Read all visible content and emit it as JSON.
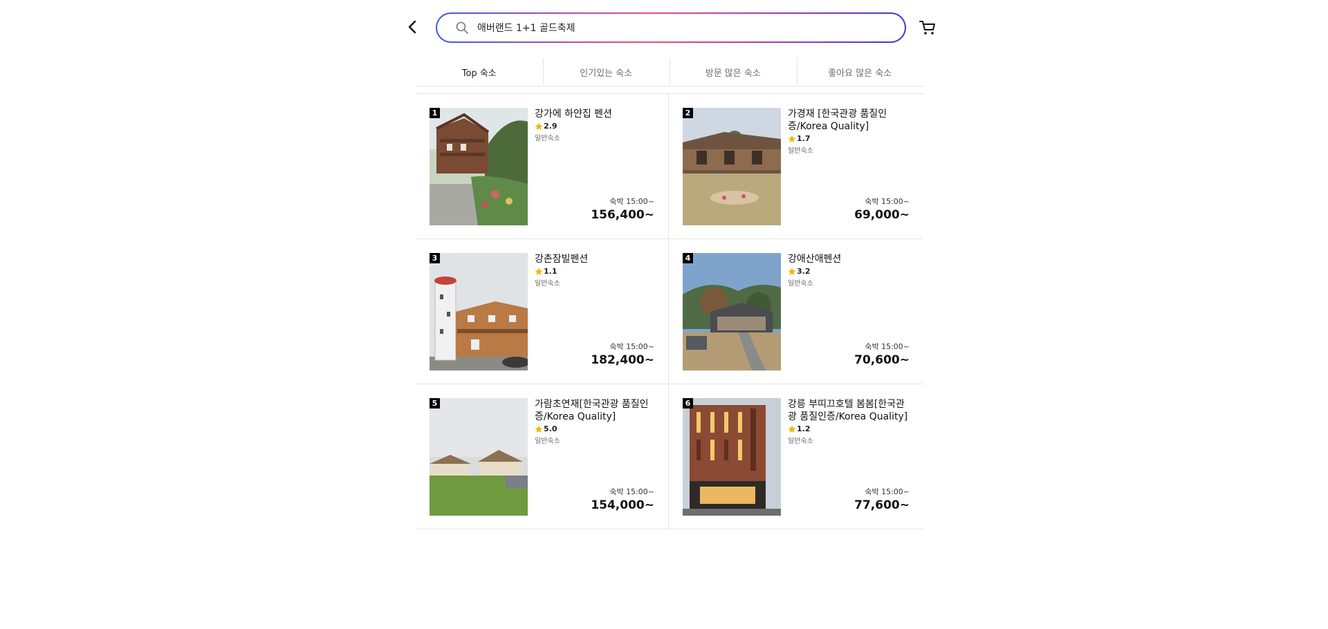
{
  "header": {
    "search_value": "애버랜드 1+1 골드축제",
    "back_icon": "chevron-left-icon",
    "search_icon": "search-icon",
    "cart_icon": "cart-icon"
  },
  "tabs": [
    {
      "label": "Top 숙소",
      "active": true
    },
    {
      "label": "인기있는 숙소",
      "active": false
    },
    {
      "label": "방문 많은 숙소",
      "active": false
    },
    {
      "label": "좋아요 많은 숙소",
      "active": false
    }
  ],
  "listings": [
    {
      "rank": "1",
      "name": "강가에 하얀집 펜션",
      "rating": "2.9",
      "category": "일반숙소",
      "stay": "숙박 15:00~",
      "price": "156,400~"
    },
    {
      "rank": "2",
      "name": "가경재 [한국관광 품질인증/Korea Quality]",
      "rating": "1.7",
      "category": "일반숙소",
      "stay": "숙박 15:00~",
      "price": "69,000~"
    },
    {
      "rank": "3",
      "name": "강촌잠빌펜션",
      "rating": "1.1",
      "category": "일반숙소",
      "stay": "숙박 15:00~",
      "price": "182,400~"
    },
    {
      "rank": "4",
      "name": "강애산애펜션",
      "rating": "3.2",
      "category": "일반숙소",
      "stay": "숙박 15:00~",
      "price": "70,600~"
    },
    {
      "rank": "5",
      "name": "가람초연재[한국관광 품질인증/Korea Quality]",
      "rating": "5.0",
      "category": "일반숙소",
      "stay": "숙박 15:00~",
      "price": "154,000~"
    },
    {
      "rank": "6",
      "name": "강릉 부띠끄호텔 봄봄[한국관광 품질인증/Korea Quality]",
      "rating": "1.2",
      "category": "일반숙소",
      "stay": "숙박 15:00~",
      "price": "77,600~"
    }
  ],
  "colors": {
    "star": "#f5b301",
    "rank_bg": "#000000",
    "search_gradient": [
      "#3d5bd9",
      "#e84d8a",
      "#4a35c9"
    ]
  }
}
